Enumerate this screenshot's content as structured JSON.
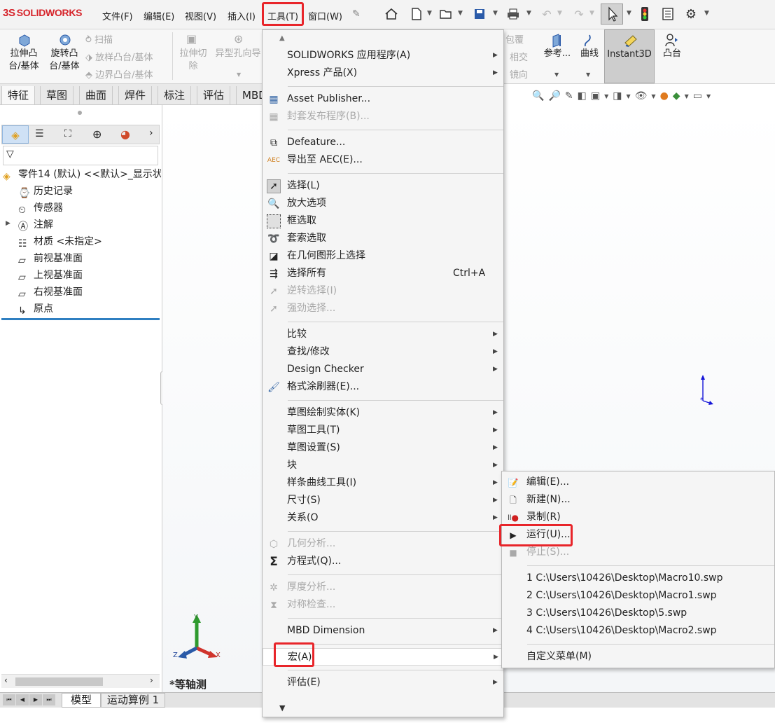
{
  "app": {
    "logo_prefix": "3S",
    "logo_text": "SOLIDWORKS"
  },
  "menubar": {
    "items": [
      "文件(F)",
      "编辑(E)",
      "视图(V)",
      "插入(I)",
      "工具(T)",
      "窗口(W)"
    ],
    "pin_icon": "pin-icon"
  },
  "ribbon": {
    "extrude_boss": "拉伸凸\n台/基体",
    "revolve_boss": "旋转凸\n台/基体",
    "sweep": "扫描",
    "loft": "放样凸台/基体",
    "boundary": "边界凸台/基体",
    "extrude_cut": "拉伸切\n除",
    "hole_wizard": "异型孔向导",
    "wrap": "包覆",
    "intersect": "相交",
    "mirror": "镜向",
    "reference": "参考...",
    "curves": "曲线",
    "instant3d": "Instant3D",
    "boss": "凸台"
  },
  "tabs": [
    "特征",
    "草图",
    "曲面",
    "焊件",
    "标注",
    "评估",
    "MBD"
  ],
  "tree": {
    "root": "零件14 (默认) <<默认>_显示状",
    "items": [
      "历史记录",
      "传感器",
      "注解",
      "材质 <未指定>",
      "前视基准面",
      "上视基准面",
      "右视基准面",
      "原点"
    ]
  },
  "viewport": {
    "view_label": "*等轴测",
    "axis_x": "X",
    "axis_y": "Y",
    "axis_z": "Z"
  },
  "bottom_tabs": [
    "模型",
    "运动算例 1"
  ],
  "tools_menu": {
    "apps": "SOLIDWORKS 应用程序(A)",
    "xpress": "Xpress 产品(X)",
    "asset_publisher": "Asset Publisher...",
    "package_publisher": "封套发布程序(B)...",
    "defeature": "Defeature...",
    "export_aec": "导出至 AEC(E)...",
    "select": "选择(L)",
    "magnify": "放大选项",
    "box_select": "框选取",
    "lasso": "套索选取",
    "select_on_geom": "在几何图形上选择",
    "select_all": "选择所有",
    "select_all_shortcut": "Ctrl+A",
    "invert_select": "逆转选择(I)",
    "power_select": "强劲选择...",
    "compare": "比较",
    "find_modify": "查找/修改",
    "design_checker": "Design Checker",
    "format_painter": "格式涂刷器(E)...",
    "sketch_entities": "草图绘制实体(K)",
    "sketch_tools": "草图工具(T)",
    "sketch_settings": "草图设置(S)",
    "blocks": "块",
    "spline_tools": "样条曲线工具(I)",
    "dimensions": "尺寸(S)",
    "relations": "关系(O",
    "geometry_analysis": "几何分析...",
    "equations": "方程式(Q)...",
    "thickness_analysis": "厚度分析...",
    "symmetry_check": "对称检查...",
    "mbd_dimension": "MBD Dimension",
    "macro": "宏(A)",
    "evaluate": "评估(E)"
  },
  "macro_menu": {
    "edit": "编辑(E)...",
    "new": "新建(N)...",
    "record": "录制(R)",
    "run": "运行(U)...",
    "stop": "停止(S)...",
    "recent1": "1 C:\\Users\\10426\\Desktop\\Macro10.swp",
    "recent2": "2 C:\\Users\\10426\\Desktop\\Macro1.swp",
    "recent3": "3 C:\\Users\\10426\\Desktop\\5.swp",
    "recent4": "4 C:\\Users\\10426\\Desktop\\Macro2.swp",
    "custom_menu": "自定义菜单(M)"
  },
  "colors": {
    "highlight": "#e8252a",
    "brand_red": "#d6232a",
    "tree_accent": "#2f7fc1"
  }
}
